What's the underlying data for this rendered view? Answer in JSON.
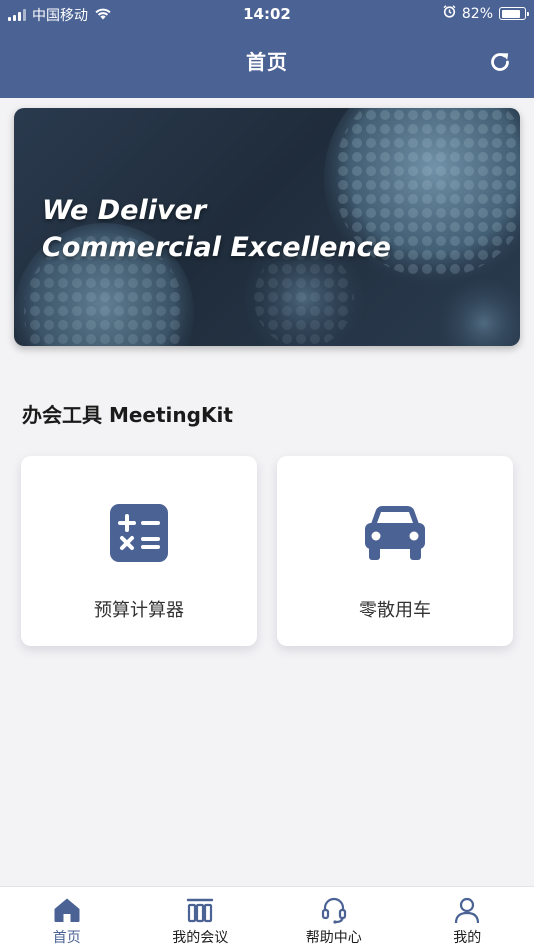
{
  "status_bar": {
    "carrier": "中国移动",
    "time": "14:02",
    "battery": "82%",
    "battery_level": 0.82
  },
  "nav": {
    "title": "首页",
    "refresh_icon": "refresh-icon"
  },
  "banner": {
    "line1": "We Deliver",
    "line2": "Commercial Excellence"
  },
  "section": {
    "title": "办会工具 MeetingKit"
  },
  "tools": [
    {
      "label": "预算计算器",
      "icon": "calculator-icon"
    },
    {
      "label": "零散用车",
      "icon": "car-icon"
    }
  ],
  "tabs": [
    {
      "label": "首页",
      "icon": "home-icon",
      "active": true
    },
    {
      "label": "我的会议",
      "icon": "meeting-icon",
      "active": false
    },
    {
      "label": "帮助中心",
      "icon": "headset-icon",
      "active": false
    },
    {
      "label": "我的",
      "icon": "user-icon",
      "active": false
    }
  ],
  "colors": {
    "brand": "#4b6294",
    "background": "#f3f3f5",
    "card": "#ffffff"
  }
}
